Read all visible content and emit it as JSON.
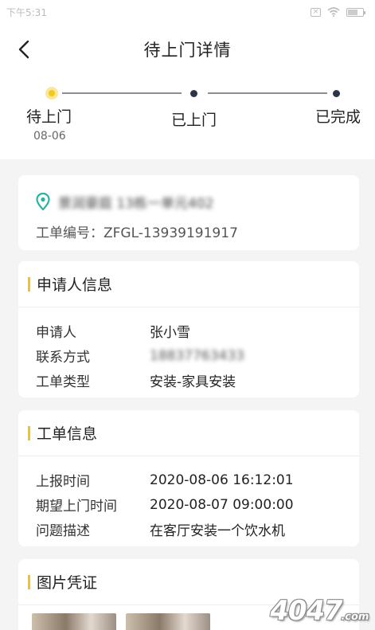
{
  "status_bar": {
    "time": "下午5:31"
  },
  "nav": {
    "title": "待上门详情"
  },
  "progress": {
    "steps": [
      {
        "label": "待上门",
        "date": "08-06",
        "state": "active"
      },
      {
        "label": "已上门",
        "date": "",
        "state": "pending"
      },
      {
        "label": "已完成",
        "date": "",
        "state": "pending"
      }
    ],
    "colors": {
      "active": "#f3c71e",
      "pending": "#2d3448",
      "line": "#8a8e97"
    }
  },
  "address_card": {
    "address": "景润豪庭 13栋一单元402",
    "order_label": "工单编号：",
    "order_no": "ZFGL-13939191917"
  },
  "applicant_card": {
    "title": "申请人信息",
    "rows": [
      {
        "key": "申请人",
        "value": "张小雪"
      },
      {
        "key": "联系方式",
        "value": "18837763433"
      },
      {
        "key": "工单类型",
        "value": "安装-家具安装"
      }
    ]
  },
  "order_card": {
    "title": "工单信息",
    "rows": [
      {
        "key": "上报时间",
        "value": "2020-08-06 16:12:01"
      },
      {
        "key": "期望上门时间",
        "value": "2020-08-07 09:00:00"
      },
      {
        "key": "问题描述",
        "value": "在客厅安装一个饮水机"
      }
    ]
  },
  "photo_card": {
    "title": "图片凭证"
  },
  "watermark": {
    "text": "4047",
    "suffix": ".com"
  },
  "accent_color": "#f0c419",
  "pin_color": "#26b3a0"
}
